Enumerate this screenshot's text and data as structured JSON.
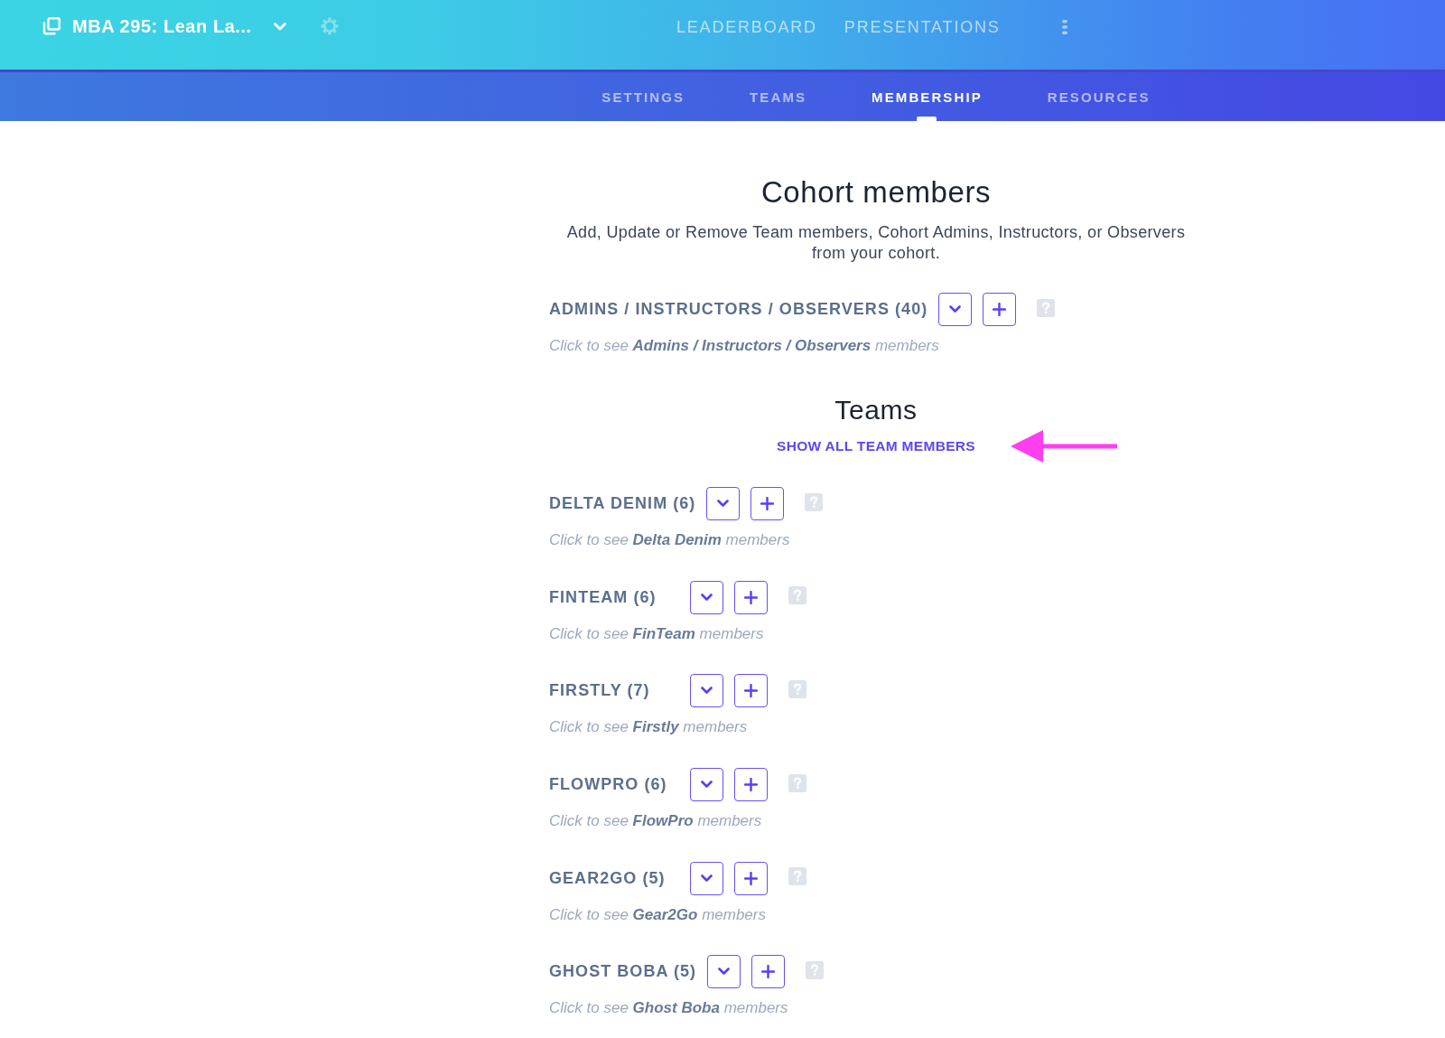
{
  "header": {
    "course_title": "MBA 295: Lean La...",
    "nav_links": [
      {
        "label": "LEADERBOARD"
      },
      {
        "label": "PRESENTATIONS"
      }
    ]
  },
  "tabs": [
    {
      "label": "SETTINGS",
      "selected": false
    },
    {
      "label": "TEAMS",
      "selected": false
    },
    {
      "label": "MEMBERSHIP",
      "selected": true
    },
    {
      "label": "RESOURCES",
      "selected": false
    }
  ],
  "cohort_members": {
    "title": "Cohort members",
    "description": "Add, Update or Remove Team members, Cohort Admins, Instructors, or Observers from your cohort.",
    "staff_group": {
      "label": "ADMINS / INSTRUCTORS / OBSERVERS (40)",
      "hint": "Click to see **Admins / Instructors / Observers** members"
    }
  },
  "teams": {
    "title": "Teams",
    "show_all_link": "SHOW ALL TEAM MEMBERS",
    "items": [
      {
        "label": "DELTA DENIM (6)",
        "hint": "Click to see **Delta Denim** members"
      },
      {
        "label": "FINTEAM (6)",
        "hint": "Click to see **FinTeam** members"
      },
      {
        "label": "FIRSTLY (7)",
        "hint": "Click to see **Firstly** members"
      },
      {
        "label": "FLOWPRO (6)",
        "hint": "Click to see **FlowPro** members"
      },
      {
        "label": "GEAR2GO (5)",
        "hint": "Click to see **Gear2Go** members"
      },
      {
        "label": "GHOST BOBA (5)",
        "hint": "Click to see **Ghost Boba** members"
      }
    ]
  }
}
